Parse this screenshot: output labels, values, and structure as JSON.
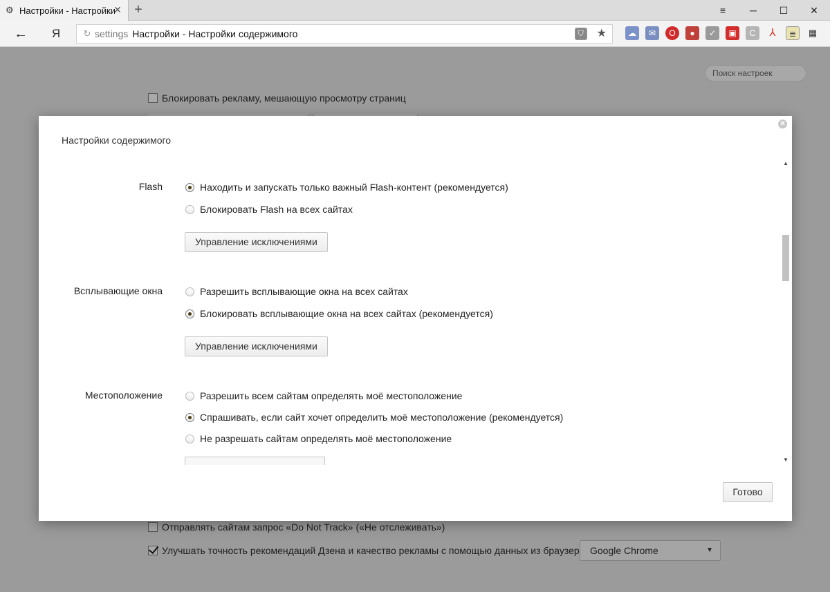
{
  "browser": {
    "tab_title": "Настройки - Настройки с",
    "tab_close": "✕",
    "new_tab": "+",
    "window": {
      "minimize": "─",
      "maximize": "☐",
      "close": "✕",
      "menu": "≡"
    },
    "back": "←",
    "yandex_button": "Я",
    "address": {
      "host": "settings",
      "title": "Настройки - Настройки содержимого"
    }
  },
  "page": {
    "search_placeholder": "Поиск настроек",
    "block_ads_label": "Блокировать рекламу, мешающую просмотру страниц",
    "do_not_track_label": "Отправлять сайтам запрос «Do Not Track» («Не отслеживать»)",
    "zen_label": "Улучшать точность рекомендаций Дзена и качество рекламы с помощью данных из браузера:",
    "zen_select_value": "Google Chrome"
  },
  "dialog": {
    "title": "Настройки содержимого",
    "close": "✕",
    "done_label": "Готово",
    "manage_exceptions_label": "Управление исключениями",
    "flash": {
      "label": "Flash",
      "options": [
        "Находить и запускать только важный Flash-контент (рекомендуется)",
        "Блокировать Flash на всех сайтах"
      ],
      "selected": 0
    },
    "popups": {
      "label": "Всплывающие окна",
      "options": [
        "Разрешить всплывающие окна на всех сайтах",
        "Блокировать всплывающие окна на всех сайтах (рекомендуется)"
      ],
      "selected": 1
    },
    "location": {
      "label": "Местоположение",
      "options": [
        "Разрешить всем сайтам определять моё местоположение",
        "Спрашивать, если сайт хочет определить моё местоположение (рекомендуется)",
        "Не разрешать сайтам определять моё местоположение"
      ],
      "selected": 1
    }
  }
}
